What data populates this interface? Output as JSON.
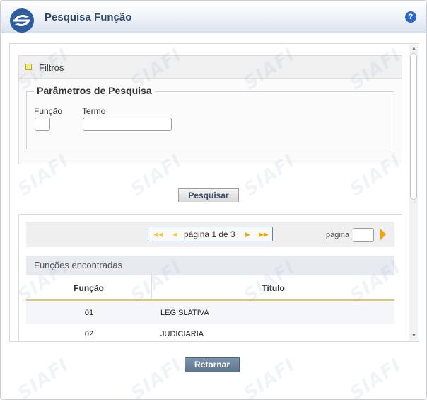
{
  "window": {
    "title": "Pesquisa Função",
    "help_label": "?",
    "logo_alt": "SIAFI"
  },
  "filters": {
    "header_label": "Filtros",
    "fieldset_legend": "Parâmetros de Pesquisa",
    "funcao_label": "Função",
    "funcao_value": "",
    "termo_label": "Termo",
    "termo_value": ""
  },
  "search_button_label": "Pesquisar",
  "pagination": {
    "text": "página 1 de 3",
    "current_page": 1,
    "total_pages": 3,
    "goto_label": "página",
    "goto_value": ""
  },
  "results": {
    "caption": "Funções encontradas",
    "columns": [
      "Função",
      "Título"
    ],
    "rows": [
      {
        "codigo": "01",
        "titulo": "LEGISLATIVA"
      },
      {
        "codigo": "02",
        "titulo": "JUDICIARIA"
      }
    ]
  },
  "footer": {
    "return_button_label": "Retornar"
  },
  "watermark_text": "SIAFI",
  "colors": {
    "title_text": "#2f4a6d",
    "accent_blue": "#2b67c7",
    "return_button": "#6a8098",
    "table_header_border": "#e3c46b",
    "go_arrow": "#f0a500"
  }
}
